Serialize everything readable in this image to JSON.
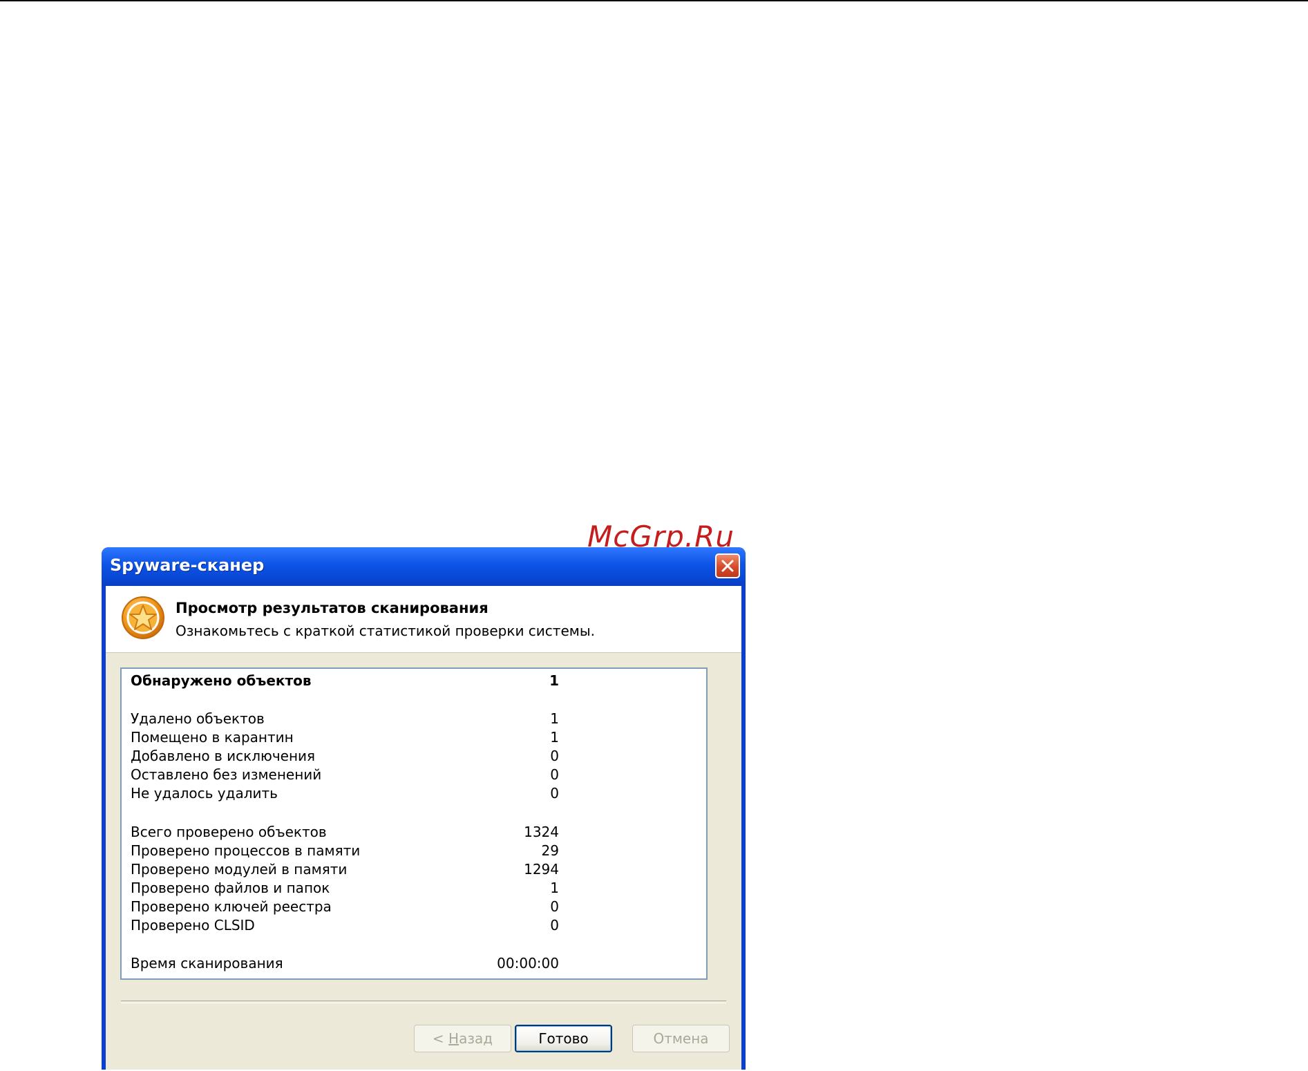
{
  "watermark": "McGrp.Ru",
  "window": {
    "title": "Spyware-сканер"
  },
  "header": {
    "title": "Просмотр результатов сканирования",
    "subtitle": "Ознакомьтесь с краткой статистикой проверки системы."
  },
  "stats": {
    "detected": {
      "label": "Обнаружено объектов",
      "value": "1"
    },
    "removed": {
      "label": "Удалено объектов",
      "value": "1"
    },
    "quarantined": {
      "label": "Помещено в карантин",
      "value": "1"
    },
    "excluded": {
      "label": "Добавлено в исключения",
      "value": "0"
    },
    "unchanged": {
      "label": "Оставлено без изменений",
      "value": "0"
    },
    "failed": {
      "label": "Не удалось удалить",
      "value": "0"
    },
    "total_checked": {
      "label": "Всего проверено объектов",
      "value": "1324"
    },
    "processes": {
      "label": "Проверено процессов в памяти",
      "value": "29"
    },
    "modules": {
      "label": "Проверено модулей в памяти",
      "value": "1294"
    },
    "files": {
      "label": "Проверено файлов и папок",
      "value": "1"
    },
    "registry": {
      "label": "Проверено ключей реестра",
      "value": "0"
    },
    "clsid": {
      "label": "Проверено CLSID",
      "value": "0"
    },
    "scan_time": {
      "label": "Время сканирования",
      "value": "00:00:00"
    }
  },
  "buttons": {
    "back_prefix": "< ",
    "back_mnemonic": "Н",
    "back_rest": "азад",
    "done": "Готово",
    "cancel": "Отмена"
  },
  "colors": {
    "titlebar": "#0d54e6",
    "close_button": "#d64a2a",
    "dialog_bg": "#ece9d8",
    "watermark": "#c51d1d"
  },
  "icons": {
    "header": "star-badge-icon",
    "close": "close-icon"
  }
}
